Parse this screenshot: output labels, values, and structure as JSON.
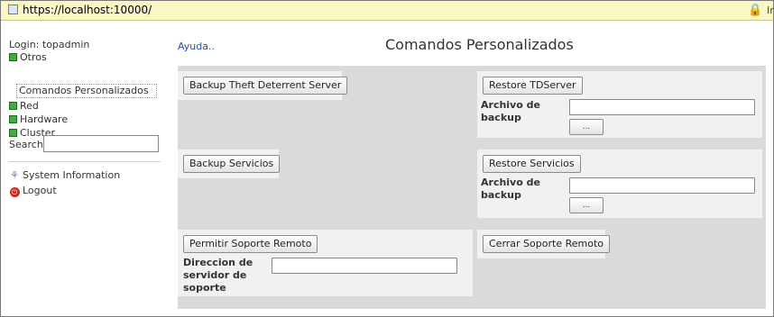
{
  "browser": {
    "url": "https://localhost:10000/",
    "right_cut_text": "Ir"
  },
  "sidebar": {
    "login": "Login: topadmin",
    "tree": [
      {
        "label": "Otros"
      },
      {
        "label": "Comandos Personalizados"
      },
      {
        "label": "Red"
      },
      {
        "label": "Hardware"
      },
      {
        "label": "Cluster"
      }
    ],
    "search_label": "Search:",
    "search_value": "",
    "links": [
      {
        "label": "System Information",
        "icon": "system-information-icon"
      },
      {
        "label": "Logout",
        "icon": "logout-icon"
      }
    ]
  },
  "header": {
    "help": "Ayuda..",
    "title": "Comandos Personalizados"
  },
  "commands": {
    "backup_tds": "Backup Theft Deterrent Server",
    "restore_tds": "Restore TDServer",
    "restore_tds_label": "Archivo de backup",
    "restore_tds_value": "",
    "browse1": "...",
    "backup_serv": "Backup Servicios",
    "restore_serv": "Restore Servicios",
    "restore_serv_label": "Archivo de backup",
    "restore_serv_value": "",
    "browse2": "...",
    "permit_remote": "Permitir Soporte Remoto",
    "server_label": "Direccion de servidor de soporte",
    "server_value": "",
    "close_remote": "Cerrar Soporte Remoto"
  },
  "colors": {
    "urlbar_bg": "#fbf7c4",
    "link": "#2a4fa0",
    "panel_bg": "#f1f1f1",
    "area_bg": "#dadada",
    "tree_toggle": "#3fae3f"
  }
}
